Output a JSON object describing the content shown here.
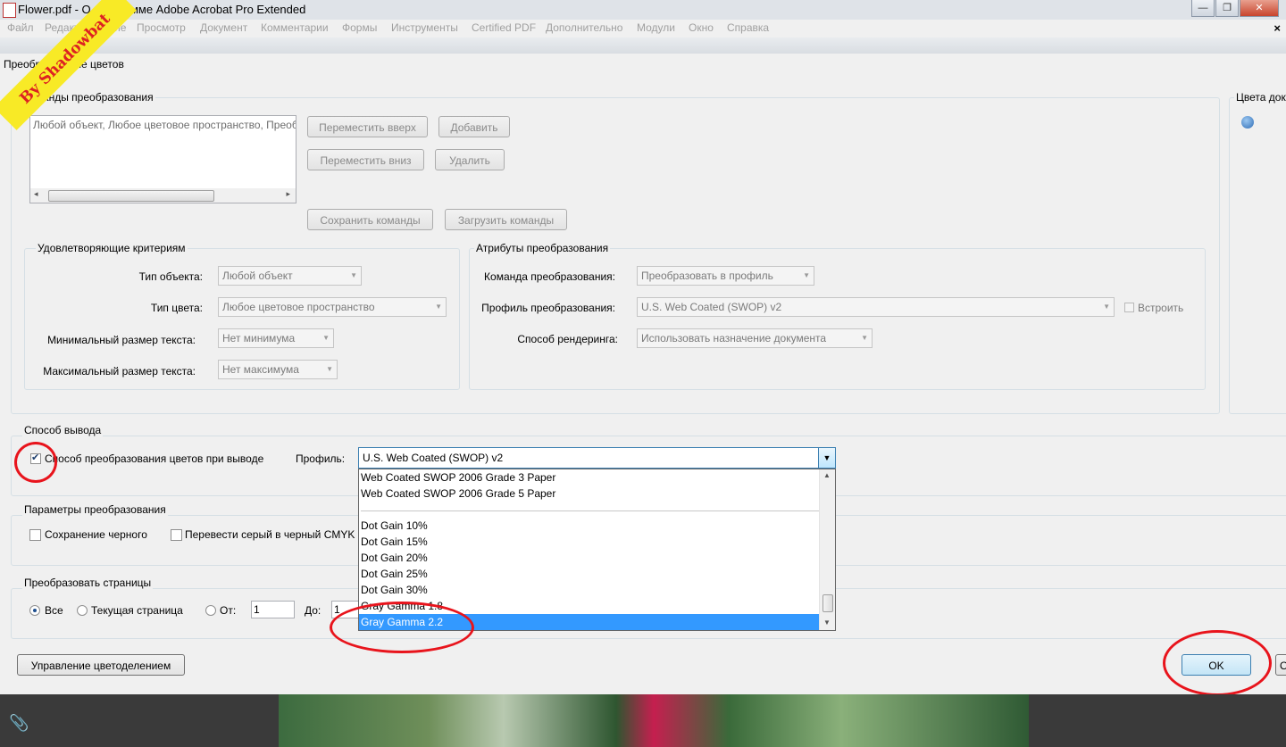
{
  "window": {
    "title": "Flower.pdf - О программе Adobe Acrobat Pro Extended",
    "controls": {
      "minimize": "—",
      "maximize": "❐",
      "close": "✕"
    }
  },
  "menu": {
    "items": [
      "Файл",
      "Редактирование",
      "Просмотр",
      "Документ",
      "Комментарии",
      "Формы",
      "Инструменты",
      "Certified PDF",
      "Дополнительно",
      "Модули",
      "Окно",
      "Справка"
    ],
    "close_glyph": "×"
  },
  "watermark": "By Shadowbat",
  "dialog": {
    "title": "Преобразование цветов",
    "commands": {
      "label": "Команды преобразования",
      "list_item": "Любой объект, Любое цветовое пространство, Преоб",
      "move_up": "Переместить вверх",
      "add": "Добавить",
      "move_down": "Переместить вниз",
      "delete": "Удалить",
      "save": "Сохранить команды",
      "load": "Загрузить команды"
    },
    "doc_colors_label": "Цвета доку",
    "criteria": {
      "label": "Удовлетворяющие критериям",
      "object_type_label": "Тип объекта:",
      "object_type_value": "Любой объект",
      "color_type_label": "Тип цвета:",
      "color_type_value": "Любое цветовое пространство",
      "min_text_label": "Минимальный размер текста:",
      "min_text_value": "Нет минимума",
      "max_text_label": "Максимальный размер текста:",
      "max_text_value": "Нет максимума"
    },
    "attributes": {
      "label": "Атрибуты преобразования",
      "command_label": "Команда преобразования:",
      "command_value": "Преобразовать в профиль",
      "profile_label": "Профиль преобразования:",
      "profile_value": "U.S. Web Coated (SWOP) v2",
      "embed_label": "Встроить",
      "rendering_label": "Способ рендеринга:",
      "rendering_value": "Использовать назначение документа"
    },
    "output": {
      "label": "Способ вывода",
      "checkbox_label": "Способ преобразования цветов при выводе",
      "checkbox_checked": true,
      "profile_label": "Профиль:",
      "profile_value": "U.S. Web Coated (SWOP) v2",
      "profile_options": [
        "Web Coated SWOP 2006 Grade 3 Paper",
        "Web Coated SWOP 2006 Grade 5 Paper",
        "Dot Gain 10%",
        "Dot Gain 15%",
        "Dot Gain 20%",
        "Dot Gain 25%",
        "Dot Gain 30%",
        "Gray Gamma 1.8",
        "Gray Gamma 2.2"
      ],
      "selected_option": "Gray Gamma 2.2"
    },
    "params": {
      "label": "Параметры преобразования",
      "preserve_black": "Сохранение черного",
      "gray_to_black": "Перевести серый в черный CMYK"
    },
    "pages": {
      "label": "Преобразовать страницы",
      "all": "Все",
      "current": "Текущая страница",
      "from_label": "От:",
      "from_value": "1",
      "to_label": "До:",
      "to_value": "1"
    },
    "separation_button": "Управление цветоделением",
    "ok_button": "OK",
    "cancel_partial": "О"
  },
  "colors": {
    "selection": "#3399ff",
    "annotation_red": "#e8141c",
    "watermark_yellow": "#f8ea26"
  }
}
